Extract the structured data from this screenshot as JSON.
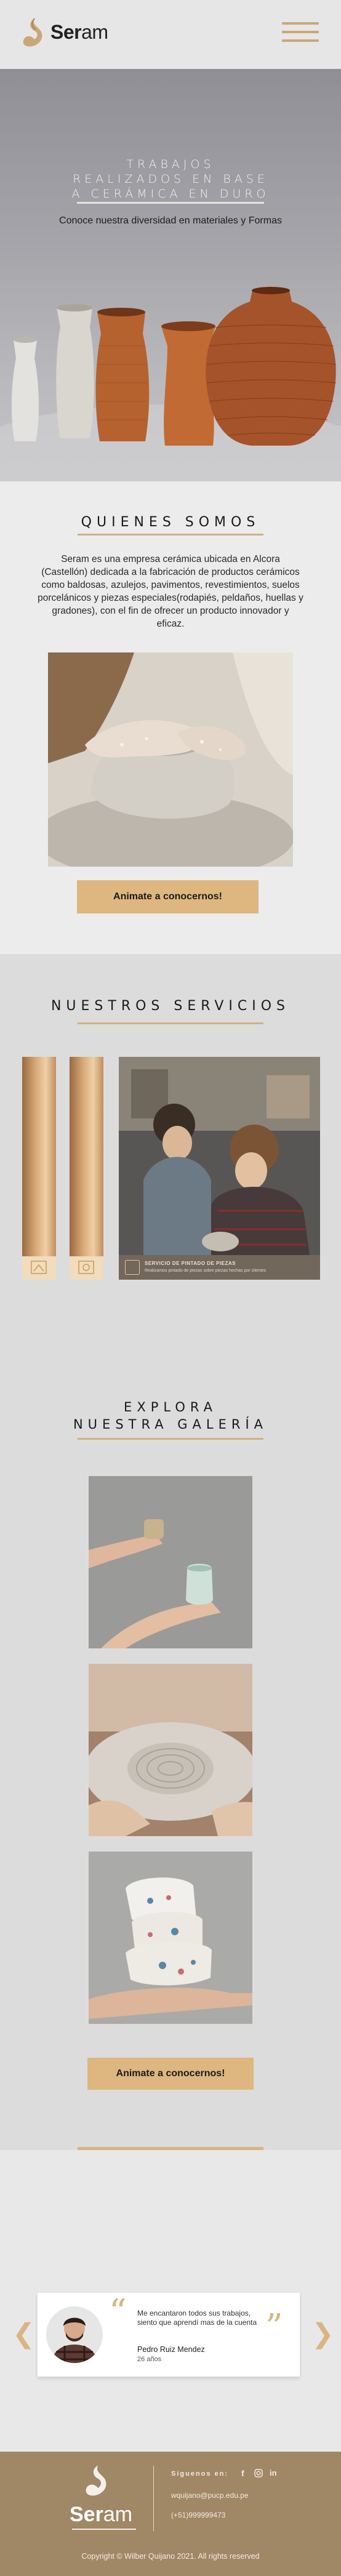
{
  "colors": {
    "gold": "#ddb77f",
    "footer": "#a08765",
    "nav": "#e6e6e6"
  },
  "nav": {
    "brand_bold": "Ser",
    "brand_light": "am",
    "menu_icon": "hamburger-icon"
  },
  "hero": {
    "title_lines": [
      "TRABAJOS",
      "REALIZADOS EN BASE",
      "A CERÁMICA EN DURO"
    ],
    "subtitle": "Conoce nuestra diversidad en materiales y Formas"
  },
  "about": {
    "title": "QUIENES SOMOS",
    "text": "Seram es una empresa cerámica ubicada en Alcora (Castellón) dedicada a la fabricación de productos cerámicos como baldosas, azulejos, pavimentos, revestimientos, suelos porcelánicos y piezas especiales(rodapiés, peldaños, huellas y gradones), con el fin de ofrecer un producto innovador y eficaz.",
    "button": "Animate a conocernos!"
  },
  "services": {
    "title": "NUESTROS SERVICIOS",
    "card_title": "SERVICIO DE PINTADO DE PIEZAS",
    "card_text": "Realizamos pintado de piezas sobre piezas hechas por clientes"
  },
  "gallery": {
    "title_line1": "EXPLORA",
    "title_line2": "NUESTRA GALERÍA",
    "button": "Animate a conocernos!"
  },
  "testimonial": {
    "quote": "Me encantaron todos sus trabajos, siento que aprendí mas de la cuenta",
    "name": "Pedro Ruiz Mendez",
    "age": "26 años"
  },
  "footer": {
    "brand_bold": "Ser",
    "brand_light": "am",
    "follow": "Siguenos en:",
    "email": "wquijano@pucp.edu.pe",
    "phone": "(+51)999999473",
    "copyright": "Copyright © Wilber Quijano 2021. All rights reserved"
  }
}
